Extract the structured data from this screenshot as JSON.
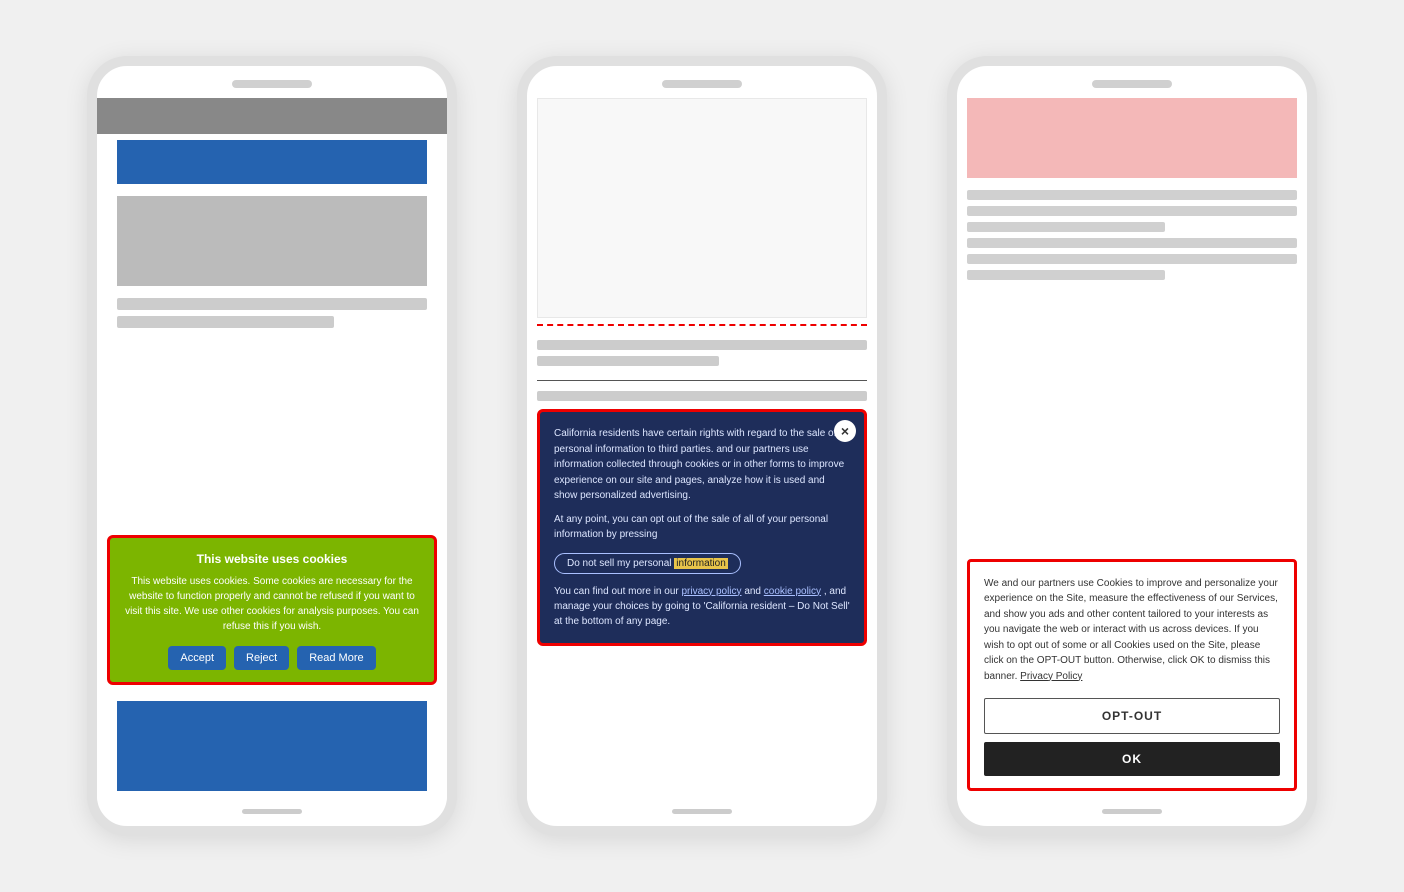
{
  "phone1": {
    "speaker": "speaker",
    "cookie_banner": {
      "title": "This website uses cookies",
      "body": "This website uses cookies. Some cookies are necessary for the website to function properly and cannot be refused if you want to visit this site. We use other cookies for analysis purposes. You can refuse this if you wish.",
      "accept_label": "Accept",
      "reject_label": "Reject",
      "read_more_label": "Read More"
    }
  },
  "phone2": {
    "speaker": "speaker",
    "cookie_banner": {
      "close_icon": "×",
      "para1": "California residents have certain rights with regard to the sale of personal information to third parties.",
      "para1b": "and our partners use information collected through cookies or in other forms to improve experience on our site and pages, analyze how it is used and show personalized advertising.",
      "para2": "At any point, you can opt out of the sale of all of your personal information by pressing",
      "do_not_sell_label": "Do not sell my personal information",
      "highlight_word": "information",
      "footer": "You can find out more in our",
      "privacy_policy_link": "privacy policy",
      "and_text": "and",
      "cookie_policy_link": "cookie policy",
      "footer2": ", and manage your choices by going to 'California resident – Do Not Sell' at the bottom of any page."
    }
  },
  "phone3": {
    "speaker": "speaker",
    "cookie_banner": {
      "body": "We and our partners use Cookies to improve and personalize your experience on the Site, measure the effectiveness of our Services, and show you ads and other content tailored to your interests as you navigate the web or interact with us across devices. If you wish to opt out of some or all Cookies used on the Site, please click on the OPT-OUT button. Otherwise, click OK to dismiss this banner.",
      "privacy_policy_link": "Privacy Policy",
      "opt_out_label": "OPT-OUT",
      "ok_label": "OK"
    }
  }
}
